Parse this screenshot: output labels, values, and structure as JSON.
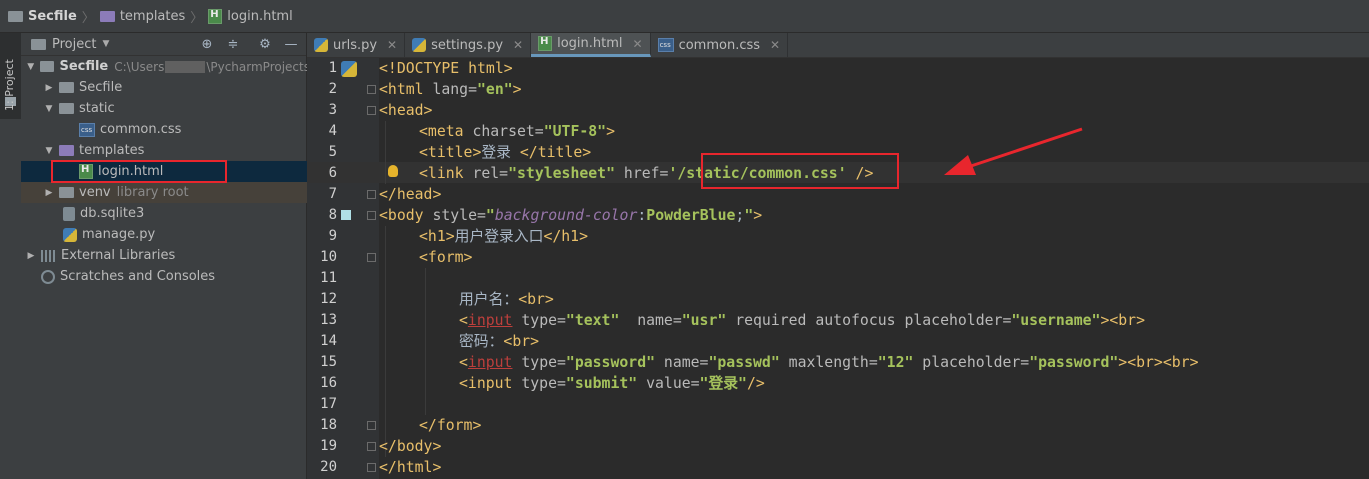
{
  "breadcrumb": {
    "items": [
      "Secfile",
      "templates",
      "login.html"
    ]
  },
  "project_panel": {
    "title": "Project",
    "tree": [
      {
        "name": "Secfile",
        "path_prefix": "C:\\Users",
        "path_suffix": "\\PycharmProjects",
        "bold": true
      },
      {
        "name": "Secfile"
      },
      {
        "name": "static"
      },
      {
        "name": "common.css"
      },
      {
        "name": "templates"
      },
      {
        "name": "login.html"
      },
      {
        "name": "venv",
        "tag": "library root"
      },
      {
        "name": "db.sqlite3"
      },
      {
        "name": "manage.py"
      },
      {
        "name": "External Libraries"
      },
      {
        "name": "Scratches and Consoles"
      }
    ]
  },
  "sidebar": {
    "project_tab": "1: Project"
  },
  "tabs": [
    {
      "label": "urls.py",
      "icon": "python-file-icon"
    },
    {
      "label": "settings.py",
      "icon": "python-file-icon"
    },
    {
      "label": "login.html",
      "icon": "html-file-icon",
      "active": true
    },
    {
      "label": "common.css",
      "icon": "css-file-icon"
    }
  ],
  "code_lines": [
    {
      "n": "1"
    },
    {
      "n": "2"
    },
    {
      "n": "3"
    },
    {
      "n": "4"
    },
    {
      "n": "5"
    },
    {
      "n": "6"
    },
    {
      "n": "7"
    },
    {
      "n": "8"
    },
    {
      "n": "9"
    },
    {
      "n": "10"
    },
    {
      "n": "11"
    },
    {
      "n": "12"
    },
    {
      "n": "13"
    },
    {
      "n": "14"
    },
    {
      "n": "15"
    },
    {
      "n": "16"
    },
    {
      "n": "17"
    },
    {
      "n": "18"
    },
    {
      "n": "19"
    },
    {
      "n": "20"
    }
  ],
  "code": {
    "l1_doctype": "<!DOCTYPE ",
    "l1_html": "html",
    "l1_end": ">",
    "l2_open": "<html ",
    "l2_attr": "lang=",
    "l2_val": "\"en\"",
    "l2_end": ">",
    "l3": "<head>",
    "l4_open": "<meta ",
    "l4_attr": "charset=",
    "l4_val": "\"UTF-8\"",
    "l4_end": ">",
    "l5_open": "<title>",
    "l5_text": "登录 ",
    "l5_close": "</title>",
    "l6_open": "<link ",
    "l6_attr1": "rel=",
    "l6_val1": "\"stylesheet\"",
    "l6_attr2": " href=",
    "l6_val2": "'/static/common.css'",
    "l6_end": " />",
    "l7": "</head>",
    "l8_open": "<body ",
    "l8_attr": "style=",
    "l8_q1": "\"",
    "l8_prop": "background-color",
    "l8_colon": ":",
    "l8_color": "PowderBlue",
    "l8_semi": ";",
    "l8_q2": "\"",
    "l8_end": ">",
    "l9_open": "<h1>",
    "l9_text": "用户登录入口",
    "l9_close": "</h1>",
    "l10": "<form>",
    "l12_text": "用户名：",
    "l12_br": "<br>",
    "l13_lt": "<",
    "l13_input": "input",
    "l13_a1": " type=",
    "l13_v1": "\"text\"",
    "l13_a2": "  name=",
    "l13_v2": "\"usr\"",
    "l13_a3": " required autofocus placeholder=",
    "l13_v3": "\"username\"",
    "l13_end": "><br>",
    "l14_text": "密码：",
    "l14_br": "<br>",
    "l15_lt": "<",
    "l15_input": "input",
    "l15_a1": " type=",
    "l15_v1": "\"password\"",
    "l15_a2": " name=",
    "l15_v2": "\"passwd\"",
    "l15_a3": " maxlength=",
    "l15_v3": "\"12\"",
    "l15_a4": " placeholder=",
    "l15_v4": "\"password\"",
    "l15_end": "><br><br>",
    "l16_open": "<input ",
    "l16_a1": "type=",
    "l16_v1": "\"submit\"",
    "l16_a2": " value=",
    "l16_v2": "\"登录\"",
    "l16_end": "/>",
    "l18": "</form>",
    "l19": "</body>",
    "l20": "</html>"
  },
  "colors": {
    "annotation_red": "#e8262d",
    "background": "#2b2b2b",
    "tag": "#e8bf6a",
    "string": "#a5c25c"
  }
}
